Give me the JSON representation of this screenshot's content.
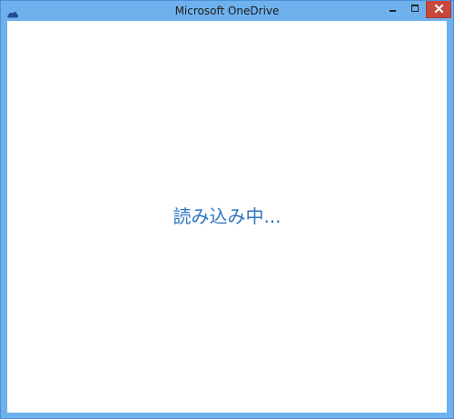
{
  "window": {
    "title": "Microsoft OneDrive",
    "icon": "onedrive-cloud-icon"
  },
  "controls": {
    "minimize_icon": "minimize-icon",
    "maximize_icon": "maximize-icon",
    "close_icon": "close-icon"
  },
  "main": {
    "loading_text": "読み込み中..."
  },
  "colors": {
    "frame": "#6fb1ec",
    "close_button": "#c7473c",
    "loading_text": "#2e75c4"
  }
}
